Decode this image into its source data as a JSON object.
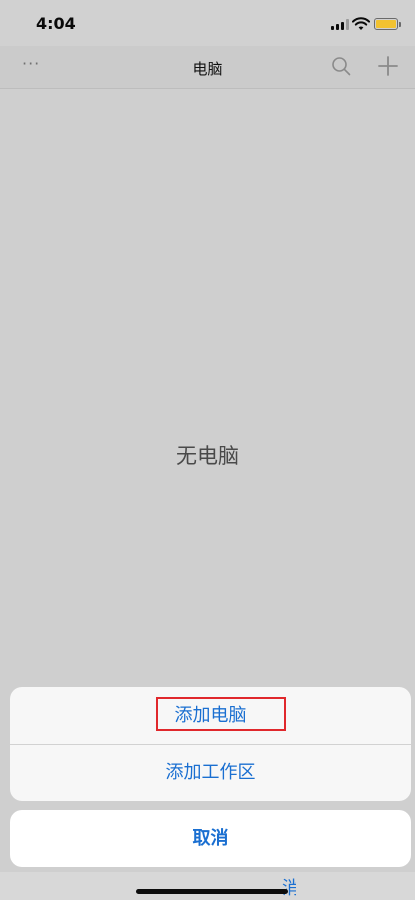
{
  "status_bar": {
    "time": "4:04",
    "signal_icon": "cellular-signal-icon",
    "wifi_icon": "wifi-icon",
    "battery_icon": "battery-icon",
    "battery_color": "#f2c230"
  },
  "nav_bar": {
    "more_label": "···",
    "title": "电脑",
    "search_icon": "search-icon",
    "add_icon": "plus-icon"
  },
  "content": {
    "empty_label": "无电脑"
  },
  "action_sheet": {
    "items": [
      {
        "label": "添加电脑",
        "highlighted": true
      },
      {
        "label": "添加工作区",
        "highlighted": false
      }
    ],
    "cancel_label": "取消",
    "accent_color": "#1a6fd1",
    "highlight_color": "#e0282c"
  },
  "bottom": {
    "partial_text": "消"
  }
}
